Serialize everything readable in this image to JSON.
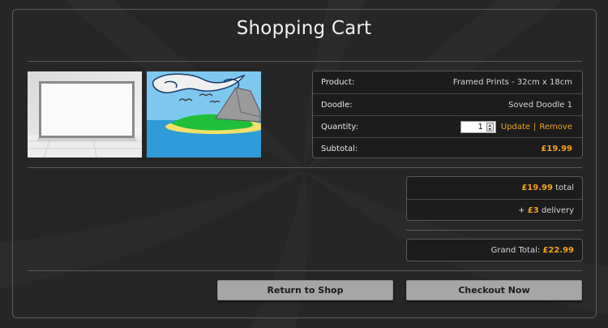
{
  "page": {
    "title": "Shopping Cart"
  },
  "details": {
    "product_label": "Product:",
    "product_value": "Framed Prints - 32cm x 18cm",
    "doodle_label": "Doodle:",
    "doodle_value": "Soved Doodle 1",
    "quantity_label": "Quantity:",
    "quantity_value": "1",
    "update_label": "Update",
    "separator": "|",
    "remove_label": "Remove",
    "subtotal_label": "Subtotal:",
    "subtotal_value": "£19.99"
  },
  "summary": {
    "total_amount": "£19.99",
    "total_suffix": "total",
    "delivery_prefix": "+",
    "delivery_amount": "£3",
    "delivery_suffix": "delivery",
    "grand_total_label": "Grand Total:",
    "grand_total_amount": "£22.99"
  },
  "buttons": {
    "return_label": "Return to Shop",
    "checkout_label": "Checkout Now"
  },
  "colors": {
    "accent": "#f2a21c",
    "background": "#262626",
    "button": "#a6a6a6"
  }
}
